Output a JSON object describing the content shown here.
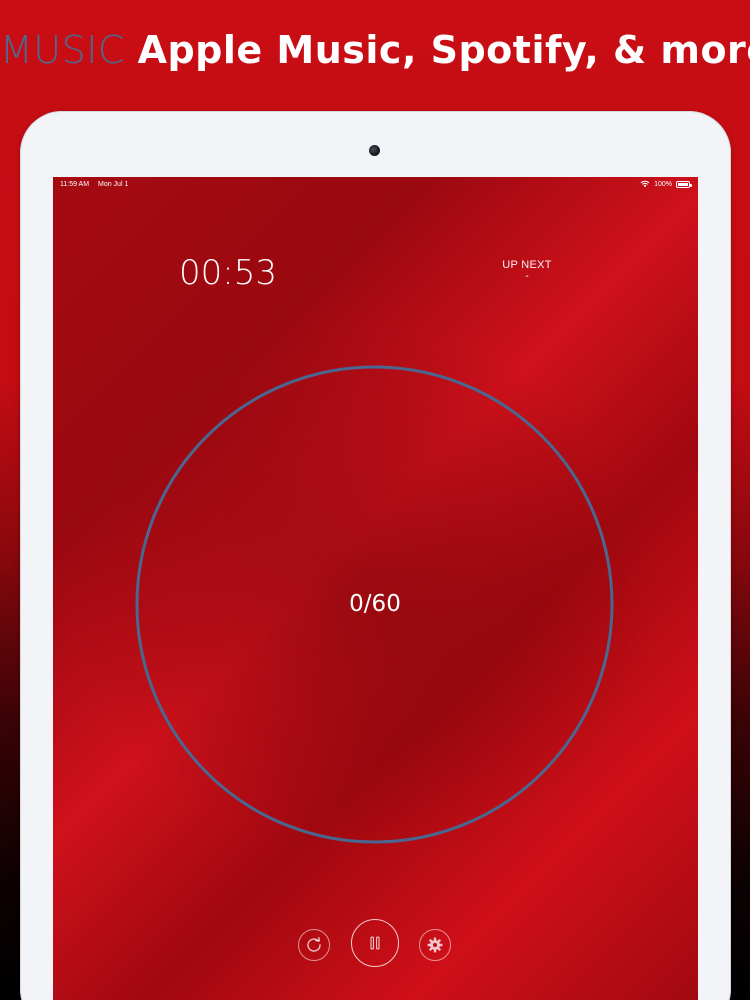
{
  "header": {
    "keyword": "MUSIC",
    "tagline": "Apple Music, Spotify, & more"
  },
  "status_bar": {
    "time": "11:59 AM",
    "date": "Mon Jul 1",
    "battery": "100%",
    "icons": [
      "wifi-icon",
      "battery-icon"
    ]
  },
  "timer": {
    "elapsed": "00:53"
  },
  "up_next": {
    "label": "UP NEXT",
    "value": "-"
  },
  "progress": {
    "count_text": "0/60",
    "fraction": 0
  },
  "controls": {
    "icons": [
      "restart-icon",
      "pause-icon",
      "gear-icon"
    ]
  },
  "colors": {
    "keyword_blue": "#4d6a8f",
    "ring_blue": "#4a6792",
    "background_red": "#c80d14"
  }
}
